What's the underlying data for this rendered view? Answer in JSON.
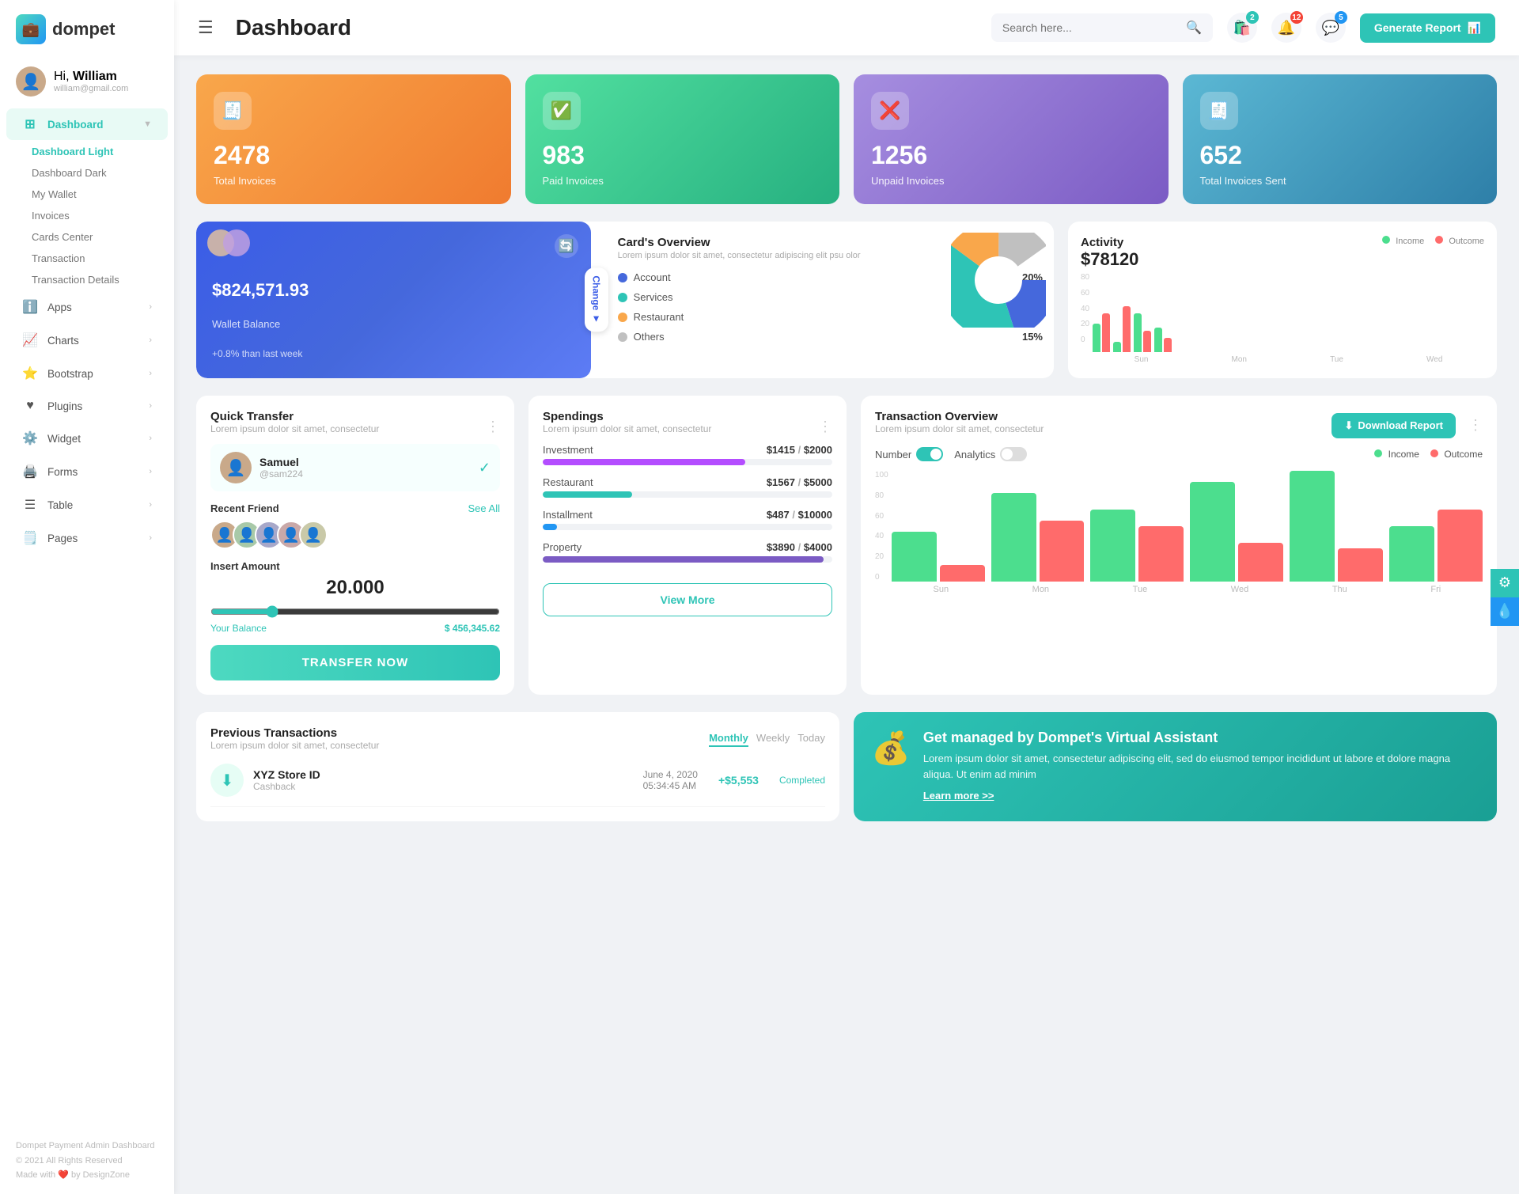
{
  "logo": {
    "text": "dompet",
    "icon": "💼"
  },
  "user": {
    "hi": "Hi,",
    "name": "William",
    "email": "william@gmail.com",
    "avatar_emoji": "👤"
  },
  "nav": {
    "dashboard_label": "Dashboard",
    "hamburger": "☰",
    "submenu": [
      {
        "id": "dashboard-light",
        "label": "Dashboard Light",
        "active": true
      },
      {
        "id": "dashboard-dark",
        "label": "Dashboard Dark",
        "active": false
      },
      {
        "id": "my-wallet",
        "label": "My Wallet",
        "active": false
      },
      {
        "id": "invoices",
        "label": "Invoices",
        "active": false
      },
      {
        "id": "cards-center",
        "label": "Cards Center",
        "active": false
      },
      {
        "id": "transaction",
        "label": "Transaction",
        "active": false
      },
      {
        "id": "transaction-details",
        "label": "Transaction Details",
        "active": false
      }
    ],
    "menu": [
      {
        "id": "apps",
        "label": "Apps",
        "icon": "ℹ️",
        "hasArrow": true
      },
      {
        "id": "charts",
        "label": "Charts",
        "icon": "📈",
        "hasArrow": true
      },
      {
        "id": "bootstrap",
        "label": "Bootstrap",
        "icon": "⭐",
        "hasArrow": true
      },
      {
        "id": "plugins",
        "label": "Plugins",
        "icon": "❤️",
        "hasArrow": true
      },
      {
        "id": "widget",
        "label": "Widget",
        "icon": "⚙️",
        "hasArrow": true
      },
      {
        "id": "forms",
        "label": "Forms",
        "icon": "🖨️",
        "hasArrow": true
      },
      {
        "id": "table",
        "label": "Table",
        "icon": "☰",
        "hasArrow": true
      },
      {
        "id": "pages",
        "label": "Pages",
        "icon": "🗒️",
        "hasArrow": true
      }
    ]
  },
  "header": {
    "title": "Dashboard",
    "search_placeholder": "Search here...",
    "notifications": [
      {
        "icon": "🛍️",
        "badge": "2",
        "badge_color": "teal"
      },
      {
        "icon": "🔔",
        "badge": "12",
        "badge_color": "red"
      },
      {
        "icon": "💬",
        "badge": "5",
        "badge_color": "blue"
      }
    ],
    "generate_btn": "Generate Report"
  },
  "stats": [
    {
      "id": "total-invoices",
      "num": "2478",
      "label": "Total Invoices",
      "icon": "🧾",
      "color": "orange"
    },
    {
      "id": "paid-invoices",
      "num": "983",
      "label": "Paid Invoices",
      "icon": "✅",
      "color": "green"
    },
    {
      "id": "unpaid-invoices",
      "num": "1256",
      "label": "Unpaid Invoices",
      "icon": "❌",
      "color": "purple"
    },
    {
      "id": "total-sent",
      "num": "652",
      "label": "Total Invoices Sent",
      "icon": "🧾",
      "color": "teal"
    }
  ],
  "wallet": {
    "balance": "$824,571.93",
    "label": "Wallet Balance",
    "change": "+0.8% than last week",
    "refresh_icon": "🔄",
    "change_label": "Change"
  },
  "cards_overview": {
    "title": "Card's Overview",
    "subtitle": "Lorem ipsum dolor sit amet, consectetur adipiscing elit psu olor",
    "items": [
      {
        "label": "Account",
        "pct": "20%",
        "color": "#4568dc"
      },
      {
        "label": "Services",
        "pct": "40%",
        "color": "#2ec4b6"
      },
      {
        "label": "Restaurant",
        "pct": "15%",
        "color": "#f9a74b"
      },
      {
        "label": "Others",
        "pct": "15%",
        "color": "#c0c0c0"
      }
    ]
  },
  "activity": {
    "title": "Activity",
    "amount": "$78120",
    "income_label": "Income",
    "outcome_label": "Outcome",
    "bars": [
      {
        "day": "Sun",
        "income": 40,
        "outcome": 55
      },
      {
        "day": "Mon",
        "income": 15,
        "outcome": 65
      },
      {
        "day": "Tue",
        "income": 55,
        "outcome": 30
      },
      {
        "day": "Wed",
        "income": 35,
        "outcome": 20
      }
    ]
  },
  "quick_transfer": {
    "title": "Quick Transfer",
    "subtitle": "Lorem ipsum dolor sit amet, consectetur",
    "contact_name": "Samuel",
    "contact_handle": "@sam224",
    "recent_friend_label": "Recent Friend",
    "see_more": "See All",
    "insert_amount_label": "Insert Amount",
    "amount": "20.000",
    "balance_label": "Your Balance",
    "balance_amount": "$ 456,345.62",
    "transfer_btn": "TRANSFER NOW"
  },
  "spendings": {
    "title": "Spendings",
    "subtitle": "Lorem ipsum dolor sit amet, consectetur",
    "items": [
      {
        "label": "Investment",
        "amount": "$1415",
        "max": "$2000",
        "pct": 70,
        "color": "#b44dff"
      },
      {
        "label": "Restaurant",
        "amount": "$1567",
        "max": "$5000",
        "pct": 31,
        "color": "#2ec4b6"
      },
      {
        "label": "Installment",
        "amount": "$487",
        "max": "$10000",
        "pct": 5,
        "color": "#2196f3"
      },
      {
        "label": "Property",
        "amount": "$3890",
        "max": "$4000",
        "pct": 97,
        "color": "#7b5bc4"
      }
    ],
    "view_more_btn": "View More"
  },
  "tx_overview": {
    "title": "Transaction Overview",
    "subtitle": "Lorem ipsum dolor sit amet, consectetur",
    "number_label": "Number",
    "analytics_label": "Analytics",
    "income_label": "Income",
    "outcome_label": "Outcome",
    "download_btn": "Download Report",
    "bars": [
      {
        "day": "Sun",
        "income": 45,
        "outcome": 15
      },
      {
        "day": "Mon",
        "income": 80,
        "outcome": 55
      },
      {
        "day": "Tue",
        "income": 65,
        "outcome": 50
      },
      {
        "day": "Wed",
        "income": 90,
        "outcome": 35
      },
      {
        "day": "Thu",
        "income": 100,
        "outcome": 30
      },
      {
        "day": "Fri",
        "income": 50,
        "outcome": 65
      }
    ],
    "y_labels": [
      "0",
      "20",
      "40",
      "60",
      "80",
      "100"
    ]
  },
  "prev_tx": {
    "title": "Previous Transactions",
    "subtitle": "Lorem ipsum dolor sit amet, consectetur",
    "tabs": [
      "Monthly",
      "Weekly",
      "Today"
    ],
    "active_tab": "Monthly",
    "rows": [
      {
        "name": "XYZ Store ID",
        "type": "Cashback",
        "date": "June 4, 2020",
        "time": "05:34:45 AM",
        "amount": "+$5,553",
        "status": "Completed"
      }
    ]
  },
  "va_banner": {
    "title": "Get managed by Dompet's Virtual Assistant",
    "text": "Lorem ipsum dolor sit amet, consectetur adipiscing elit, sed do eiusmod tempor incididunt ut labore et dolore magna aliqua. Ut enim ad minim",
    "link": "Learn more >>"
  },
  "footer": {
    "brand": "Dompet Payment Admin Dashboard",
    "copy": "© 2021 All Rights Reserved",
    "made_with": "Made with",
    "by": "by DesignZone"
  }
}
